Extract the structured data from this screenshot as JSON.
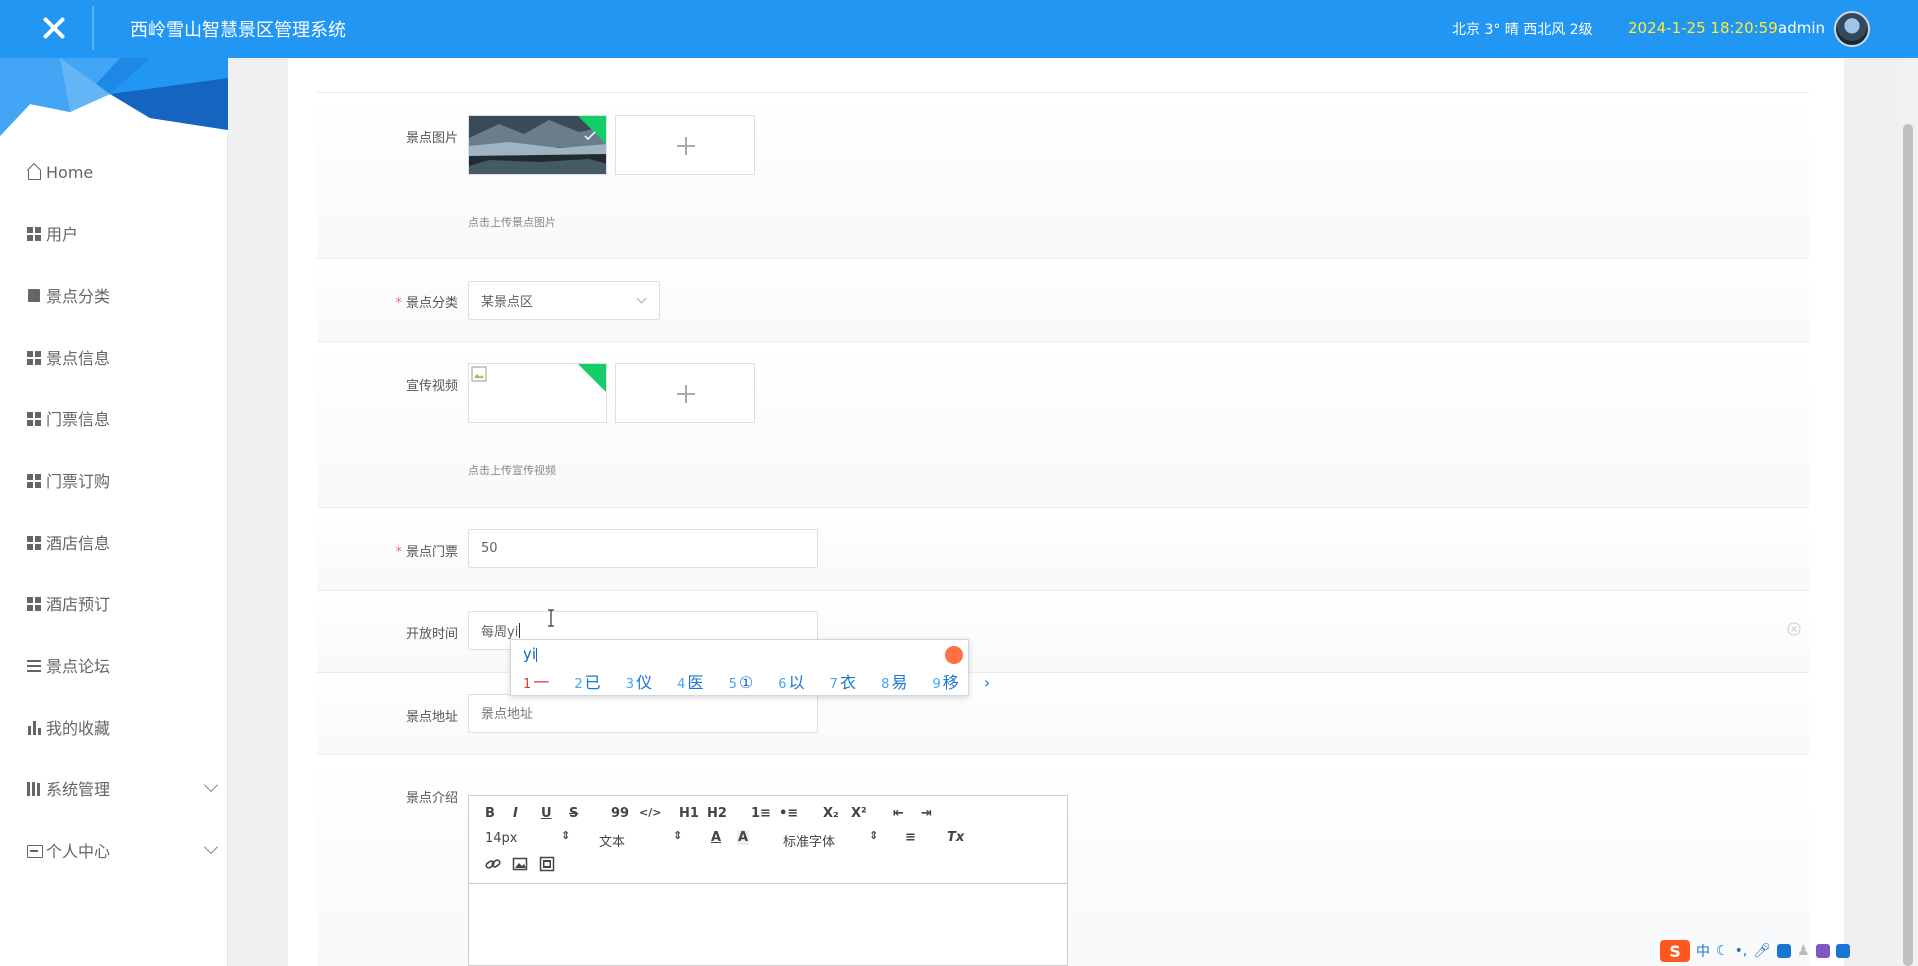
{
  "header": {
    "app_title": "西岭雪山智慧景区管理系统",
    "weather": "北京  3°  晴  西北风  2级",
    "datetime": "2024-1-25 18:20:59",
    "username": "admin"
  },
  "sidebar": {
    "items": [
      {
        "label": "Home",
        "icon": "home-icon"
      },
      {
        "label": "用户",
        "icon": "grid-icon"
      },
      {
        "label": "景点分类",
        "icon": "clipboard-icon"
      },
      {
        "label": "景点信息",
        "icon": "grid-icon"
      },
      {
        "label": "门票信息",
        "icon": "grid-icon"
      },
      {
        "label": "门票订购",
        "icon": "grid-icon"
      },
      {
        "label": "酒店信息",
        "icon": "grid-icon"
      },
      {
        "label": "酒店预订",
        "icon": "grid-icon"
      },
      {
        "label": "景点论坛",
        "icon": "list-icon"
      },
      {
        "label": "我的收藏",
        "icon": "bar-chart-icon"
      },
      {
        "label": "系统管理",
        "icon": "library-icon"
      },
      {
        "label": "个人中心",
        "icon": "id-card-icon"
      }
    ]
  },
  "form": {
    "image_label": "景点图片",
    "image_hint": "点击上传景点图片",
    "category_label": "景点分类",
    "category_value": "某景点区",
    "video_label": "宣传视频",
    "video_hint": "点击上传宣传视频",
    "ticket_label": "景点门票",
    "ticket_value": "50",
    "open_time_label": "开放时间",
    "open_time_value": "每周yi",
    "address_label": "景点地址",
    "address_placeholder": "景点地址",
    "intro_label": "景点介绍",
    "required_mark": "*"
  },
  "editor": {
    "bold": "B",
    "italic": "I",
    "underline": "U",
    "strike": "S",
    "quote": "99",
    "code": "</>",
    "h1": "H1",
    "h2": "H2",
    "ordered_list": "1≡",
    "bullet_list": "•≡",
    "subscript": "X₂",
    "superscript": "X²",
    "outdent": "⇤",
    "indent": "⇥",
    "font_size": "14px",
    "text_style": "文本",
    "font_color": "A",
    "bg_color": "A",
    "font_family": "标准字体",
    "align": "≡",
    "clear_format": "Tx"
  },
  "ime": {
    "composition": "yi",
    "candidates": [
      {
        "num": "1",
        "text": "一"
      },
      {
        "num": "2",
        "text": "已"
      },
      {
        "num": "3",
        "text": "仪"
      },
      {
        "num": "4",
        "text": "医"
      },
      {
        "num": "5",
        "text": "①"
      },
      {
        "num": "6",
        "text": "以"
      },
      {
        "num": "7",
        "text": "衣"
      },
      {
        "num": "8",
        "text": "易"
      },
      {
        "num": "9",
        "text": "移"
      }
    ],
    "next": "›"
  },
  "taskbar_ime": {
    "logo": "S",
    "mode": "中"
  },
  "colors": {
    "header_bg": "#2196f3",
    "datetime": "#ffeb3b",
    "required": "#f56c6c",
    "upload_corner": "#13ce66"
  }
}
